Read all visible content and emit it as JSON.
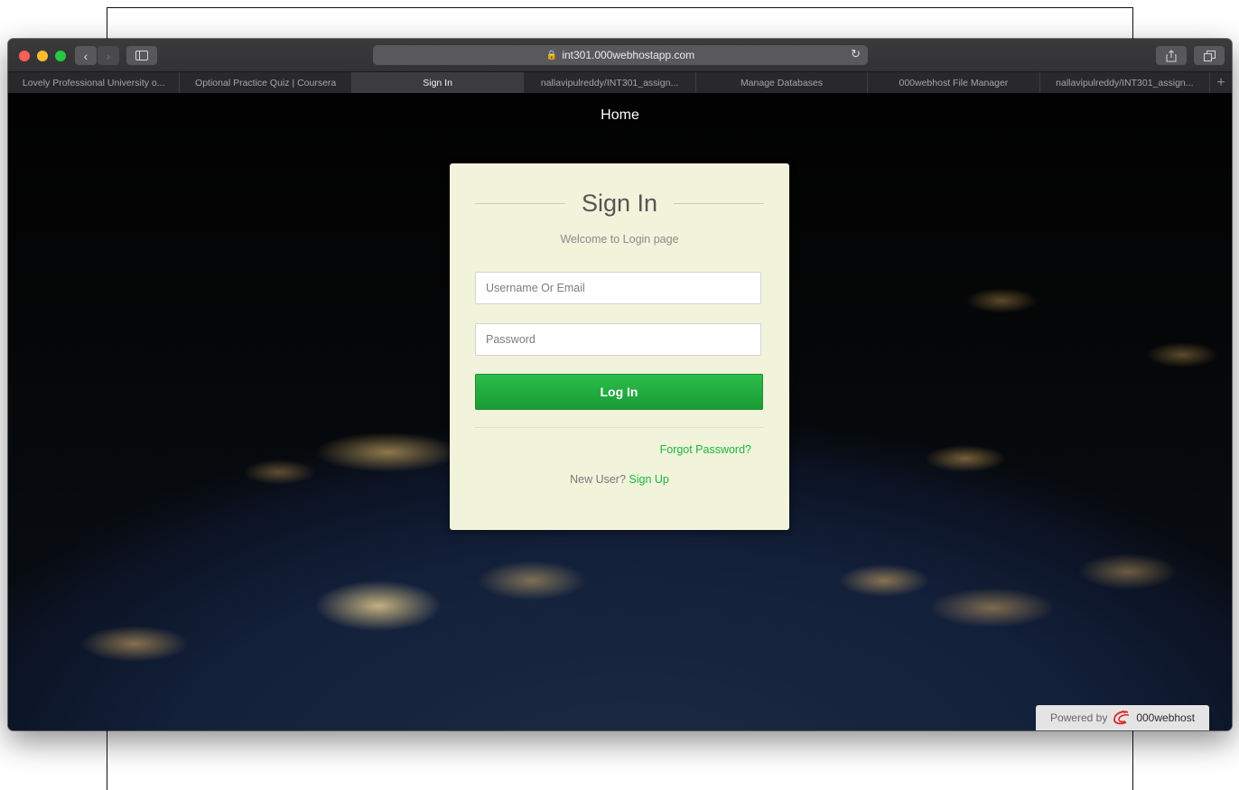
{
  "browser": {
    "url": "int301.000webhostapp.com",
    "tabs": [
      {
        "label": "Lovely Professional University o...",
        "active": false
      },
      {
        "label": "Optional Practice Quiz | Coursera",
        "active": false
      },
      {
        "label": "Sign In",
        "active": true
      },
      {
        "label": "nallavipulreddy/INT301_assign...",
        "active": false
      },
      {
        "label": "Manage Databases",
        "active": false
      },
      {
        "label": "000webhost File Manager",
        "active": false
      },
      {
        "label": "nallavipulreddy/INT301_assign...",
        "active": false
      }
    ]
  },
  "page": {
    "nav_home": "Home",
    "title": "Sign In",
    "subtitle": "Welcome to Login page",
    "username_placeholder": "Username Or Email",
    "password_placeholder": "Password",
    "login_label": "Log In",
    "forgot_label": "Forgot Password?",
    "new_user_text": "New User?",
    "signup_label": "Sign Up"
  },
  "footer": {
    "powered_text": "Powered by",
    "brand": "000webhost"
  },
  "colors": {
    "accent_green": "#1bb640",
    "button_green": "#22a83f",
    "card_bg": "#f1f3db"
  }
}
